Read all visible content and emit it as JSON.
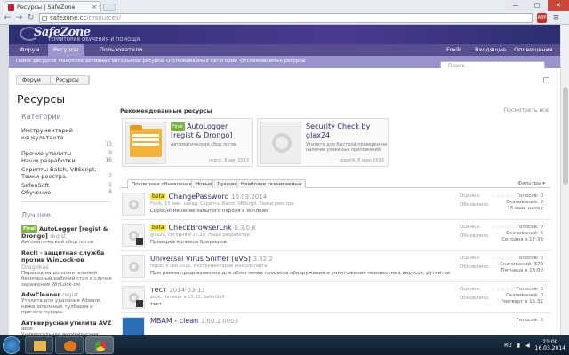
{
  "browser": {
    "tab_title": "Ресурсы | SafeZone",
    "tab_close": "×",
    "url_host": "safezone.cc",
    "url_path": "/resources/",
    "ext_badge": "ABP",
    "window_min": "—",
    "window_max": "□",
    "window_close": "✕"
  },
  "site": {
    "logo": "SafeZone",
    "logo_sub": "ТЕРРИТОРИЯ ОБУЧЕНИЯ И ПОМОЩИ"
  },
  "mainnav": {
    "items": [
      "Форум",
      "Ресурсы",
      "Пользователи"
    ],
    "right": [
      "Foxik",
      "Входящие",
      "Оповещения"
    ]
  },
  "subnav": {
    "items": [
      "Поиск ресурсов",
      "Наиболее активные авторы",
      "Мои ресурсы",
      "Отслеживаемые категории",
      "Отслеживаемые ресурсы"
    ],
    "search_placeholder": "Поиск..."
  },
  "breadcrumb": [
    "Форум",
    "Ресурсы"
  ],
  "page_title": "Ресурсы",
  "categories": {
    "heading": "Категории",
    "items": [
      {
        "name": "Инструментарий консультанта",
        "count": "13"
      },
      {
        "name": "Прочие утилиты",
        "count": "9"
      },
      {
        "name": "Наши разработки",
        "count": "16"
      },
      {
        "name": "Скрипты Batch, VBScript. Твики реестра.",
        "count": "2"
      },
      {
        "name": "SafenSoft",
        "count": "1"
      },
      {
        "name": "Обучение",
        "count": "8"
      }
    ]
  },
  "best": {
    "heading": "Лучшие",
    "items": [
      {
        "badge": "Final",
        "title": "AutoLogger [regist & Drongo]",
        "author": "regist",
        "desc": "Автоматический сбор логов."
      },
      {
        "badge": "",
        "title": "RecIt - защитная служба против WinLock-ов",
        "author": "Dragokas",
        "desc": "Перевод на дополнительный безопасный рабочий стол в случае заражения WinLock-ом"
      },
      {
        "badge": "",
        "title": "AdwCleaner",
        "author": "regist",
        "desc": "Утилита для удаления Adware, нежелательных тулбаров и прочего мусора."
      },
      {
        "badge": "",
        "title": "Антивирусная утилита AVZ",
        "author": "akok",
        "desc": "Универсальная антивирусная утилита"
      }
    ]
  },
  "recommended": {
    "heading": "Рекомендованные ресурсы",
    "more": "Посмотреть все",
    "cards": [
      {
        "badge": "Final",
        "title": "AutoLogger [regist & Drongo]",
        "desc": "Автоматический сбор логов.",
        "meta": "regist, 8 авг 2013"
      },
      {
        "badge": "",
        "title": "Security Check by glax24",
        "desc": "Утилита для быстрой проверки на наличие уязвимых приложений",
        "meta": "glax24, 8 июн 2013"
      }
    ]
  },
  "list_tabs": [
    "Последние обновления",
    "Новые",
    "Лучшие",
    "Наиболее скачиваемые"
  ],
  "filters": "Фильтры ▾",
  "resources": [
    {
      "prefix": "beta",
      "title": "ChangePassword",
      "version": "16.03.2014",
      "meta": "Foxik, 15 мин. назад, Скрипты Batch, VBScript. Твики реестра.",
      "desc": "Сброс/изменение забытого пароля в Windows",
      "rating_label": "Оценка:",
      "stars": "☆☆☆☆☆",
      "updated_label": "Обновлено:",
      "votes": "Голосов: 0",
      "downloads": "Скачиваний: 0",
      "updated": "15 мин. назад"
    },
    {
      "prefix": "beta",
      "title": "CheckBrowserLnk",
      "version": "0.3.0.8",
      "meta": "glax24, сегодня в 17:29, Наши разработки",
      "desc": "Проверка ярлыков браузеров",
      "rating_label": "Оценка:",
      "stars": "☆☆☆☆☆",
      "updated_label": "Обновлено:",
      "votes": "Голосов: 0",
      "downloads": "Скачиваний: 6",
      "updated": "Сегодня в 17:39"
    },
    {
      "prefix": "",
      "title": "Universal Virus Sniffer (uVS)",
      "version": "3.82.2",
      "meta": "regist, 9 сен 2013, Инструментарий консультанта",
      "desc": "Программа предназначена для облегчения процесса обнаружения и уничтожения неизвестных вирусов, руткитов",
      "rating_label": "Оценка:",
      "stars": "☆☆☆☆☆",
      "updated_label": "Обновлено:",
      "votes": "Голосов: 0",
      "downloads": "Скачиваний: 379",
      "updated": "Пятница в 18:00"
    },
    {
      "prefix": "",
      "title": "тест",
      "version": "2014-03-13",
      "meta": "akok, Четверг в 15:31, SafenSoft",
      "desc": "тест",
      "rating_label": "Оценка:",
      "stars": "☆☆☆☆☆",
      "updated_label": "Обновлено:",
      "votes": "Голосов: 0",
      "downloads": "Скачиваний: 0",
      "updated": "Четверг в 15:31"
    },
    {
      "prefix": "",
      "title": "MBAM - clean",
      "version": "1.60.2.0003",
      "meta": "",
      "desc": "",
      "rating_label": "",
      "stars": "",
      "updated_label": "",
      "votes": "Голосов: 0",
      "downloads": "",
      "updated": ""
    }
  ],
  "taskbar": {
    "lang": "RU",
    "time": "21:00",
    "date": "16.03.2014"
  },
  "colors": {
    "banner": "#3b3580",
    "nav_active": "#9c97cd",
    "beta_badge": "#ffe92e",
    "final_badge": "#7bb33e"
  }
}
